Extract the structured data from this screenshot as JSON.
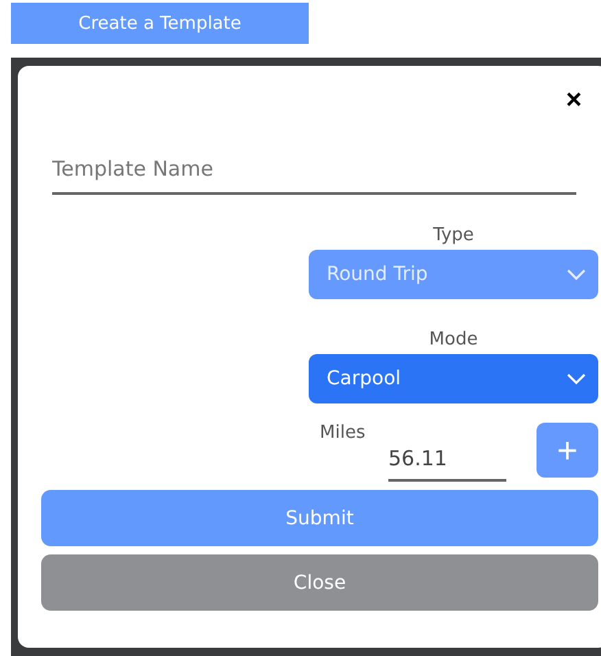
{
  "create_button": {
    "label": "Create a Template"
  },
  "modal": {
    "close_label": "×",
    "template_name": {
      "placeholder": "Template Name"
    },
    "selects": [
      {
        "label": "Type",
        "value": "Round Trip",
        "focused": false
      },
      {
        "label": "Mode",
        "value": "Carpool",
        "focused": true
      }
    ],
    "miles": {
      "label": "Miles",
      "value": "56.11",
      "add_label": "+"
    },
    "buttons": [
      {
        "label": "Submit",
        "kind": "primary"
      },
      {
        "label": "Close",
        "kind": "secondary"
      }
    ]
  }
}
